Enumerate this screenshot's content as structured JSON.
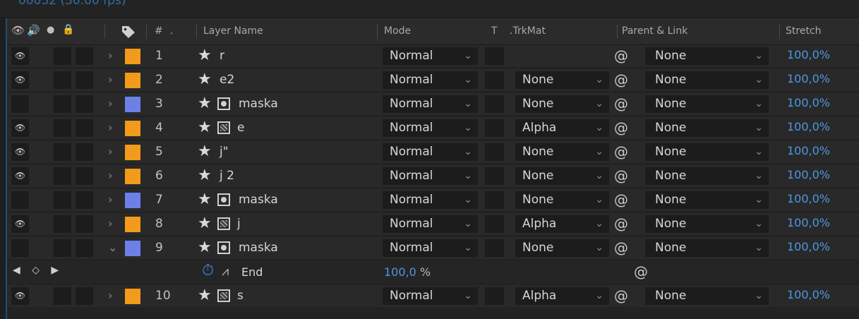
{
  "top": {
    "timecode": "00032 (30.00 fps)"
  },
  "header": {
    "col_num": "#",
    "col_layer_name": "Layer Name",
    "col_mode": "Mode",
    "col_t": "T",
    "col_trkmat": ".TrkMat",
    "col_parent": "Parent & Link",
    "col_stretch": "Stretch"
  },
  "icons": {
    "eye": "👁",
    "audio": "🔊",
    "solo": "●",
    "lock": "🔒",
    "tag": "label-tag-icon",
    "twirl_closed": "›",
    "twirl_open": "⌄",
    "star": "★",
    "chevron": "⌄",
    "pickwhip": "@",
    "stopwatch": "⏱",
    "graph": "⩘",
    "keyframe_nav": "◀ ◇ ▶"
  },
  "colors": {
    "orange_label": "#f29a1a",
    "blue_label": "#6e80e8",
    "stretch_blue": "#4f96e2"
  },
  "layers": [
    {
      "num": "1",
      "name": "r",
      "type": "none",
      "label": "#f29a1a",
      "visible": true,
      "mode": "Normal",
      "trkmat": "",
      "parent": "None",
      "stretch": "100,0%"
    },
    {
      "num": "2",
      "name": "e2",
      "type": "none",
      "label": "#f29a1a",
      "visible": true,
      "mode": "Normal",
      "trkmat": "None",
      "parent": "None",
      "stretch": "100,0%"
    },
    {
      "num": "3",
      "name": "maska",
      "type": "mask",
      "label": "#6e80e8",
      "visible": false,
      "mode": "Normal",
      "trkmat": "None",
      "parent": "None",
      "stretch": "100,0%"
    },
    {
      "num": "4",
      "name": "e",
      "type": "precomp",
      "label": "#f29a1a",
      "visible": true,
      "mode": "Normal",
      "trkmat": "Alpha",
      "parent": "None",
      "stretch": "100,0%"
    },
    {
      "num": "5",
      "name": "j\"",
      "type": "none",
      "label": "#f29a1a",
      "visible": true,
      "mode": "Normal",
      "trkmat": "None",
      "parent": "None",
      "stretch": "100,0%"
    },
    {
      "num": "6",
      "name": "j 2",
      "type": "none",
      "label": "#f29a1a",
      "visible": true,
      "mode": "Normal",
      "trkmat": "None",
      "parent": "None",
      "stretch": "100,0%"
    },
    {
      "num": "7",
      "name": "maska",
      "type": "mask",
      "label": "#6e80e8",
      "visible": false,
      "mode": "Normal",
      "trkmat": "None",
      "parent": "None",
      "stretch": "100,0%"
    },
    {
      "num": "8",
      "name": "j",
      "type": "precomp",
      "label": "#f29a1a",
      "visible": true,
      "mode": "Normal",
      "trkmat": "Alpha",
      "parent": "None",
      "stretch": "100,0%"
    },
    {
      "num": "9",
      "name": "maska",
      "type": "mask",
      "label": "#6e80e8",
      "visible": false,
      "mode": "Normal",
      "trkmat": "None",
      "parent": "None",
      "stretch": "100,0%",
      "expanded": true
    }
  ],
  "property_row": {
    "name": "End",
    "value": "100,0",
    "unit": "%"
  },
  "last_layer": {
    "num": "10",
    "name": "s",
    "type": "precomp",
    "label": "#f29a1a",
    "visible": true,
    "mode": "Normal",
    "trkmat": "Alpha",
    "parent": "None",
    "stretch": "100,0%"
  }
}
